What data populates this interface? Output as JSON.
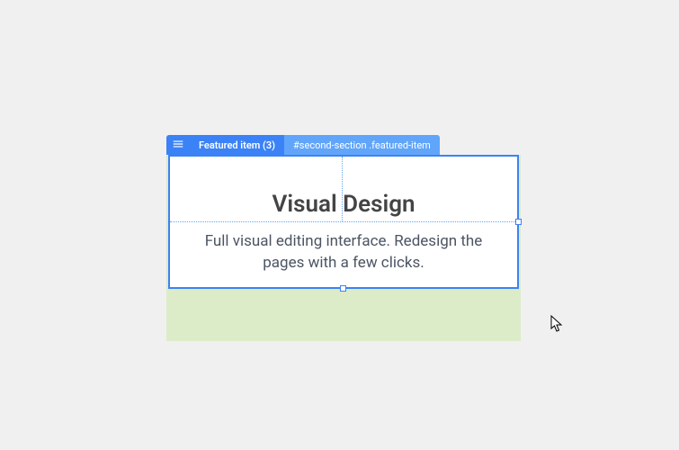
{
  "toolbar": {
    "label": "Featured item (3)",
    "selector": "#second-section .featured-item"
  },
  "card": {
    "title": "Visual Design",
    "text": "Full visual editing interface. Redesign the pages with a few clicks."
  }
}
